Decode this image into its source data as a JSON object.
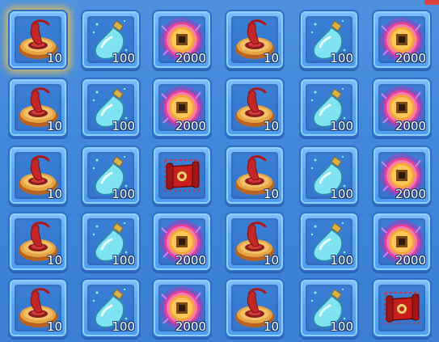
{
  "grid": {
    "rows": [
      [
        {
          "item": "incense",
          "icon": "incense-censer-icon",
          "count": "10",
          "glow": true
        },
        {
          "item": "potion",
          "icon": "potion-bottle-icon",
          "count": "100"
        },
        {
          "item": "coin",
          "icon": "ancient-coin-icon",
          "count": "2000"
        },
        {
          "item": "incense",
          "icon": "incense-censer-icon",
          "count": "10"
        },
        {
          "item": "potion",
          "icon": "potion-bottle-icon",
          "count": "100"
        },
        {
          "item": "coin",
          "icon": "ancient-coin-icon",
          "count": "2000"
        }
      ],
      [
        {
          "item": "incense",
          "icon": "incense-censer-icon",
          "count": "10"
        },
        {
          "item": "potion",
          "icon": "potion-bottle-icon",
          "count": "100"
        },
        {
          "item": "coin",
          "icon": "ancient-coin-icon",
          "count": "2000"
        },
        {
          "item": "incense",
          "icon": "incense-censer-icon",
          "count": "10"
        },
        {
          "item": "potion",
          "icon": "potion-bottle-icon",
          "count": "100"
        },
        {
          "item": "coin",
          "icon": "ancient-coin-icon",
          "count": "2000"
        }
      ],
      [
        {
          "item": "incense",
          "icon": "incense-censer-icon",
          "count": "10"
        },
        {
          "item": "potion",
          "icon": "potion-bottle-icon",
          "count": "100"
        },
        {
          "item": "scroll",
          "icon": "red-scroll-icon",
          "count": ""
        },
        {
          "item": "incense",
          "icon": "incense-censer-icon",
          "count": "10"
        },
        {
          "item": "potion",
          "icon": "potion-bottle-icon",
          "count": "100"
        },
        {
          "item": "coin",
          "icon": "ancient-coin-icon",
          "count": "2000"
        }
      ],
      [
        {
          "item": "incense",
          "icon": "incense-censer-icon",
          "count": "10"
        },
        {
          "item": "potion",
          "icon": "potion-bottle-icon",
          "count": "100"
        },
        {
          "item": "coin",
          "icon": "ancient-coin-icon",
          "count": "2000"
        },
        {
          "item": "incense",
          "icon": "incense-censer-icon",
          "count": "10"
        },
        {
          "item": "potion",
          "icon": "potion-bottle-icon",
          "count": "100"
        },
        {
          "item": "coin",
          "icon": "ancient-coin-icon",
          "count": "2000"
        }
      ],
      [
        {
          "item": "incense",
          "icon": "incense-censer-icon",
          "count": "10"
        },
        {
          "item": "potion",
          "icon": "potion-bottle-icon",
          "count": "100"
        },
        {
          "item": "coin",
          "icon": "ancient-coin-icon",
          "count": "2000"
        },
        {
          "item": "incense",
          "icon": "incense-censer-icon",
          "count": "10"
        },
        {
          "item": "potion",
          "icon": "potion-bottle-icon",
          "count": "100"
        },
        {
          "item": "scroll",
          "icon": "red-scroll-icon",
          "count": ""
        }
      ]
    ]
  },
  "colors": {
    "background": "#4288da",
    "slot_frame": "#5aa8f5",
    "slot_inner": "#3575cc",
    "count_text": "#ffffff",
    "count_outline": "#153a6e"
  }
}
